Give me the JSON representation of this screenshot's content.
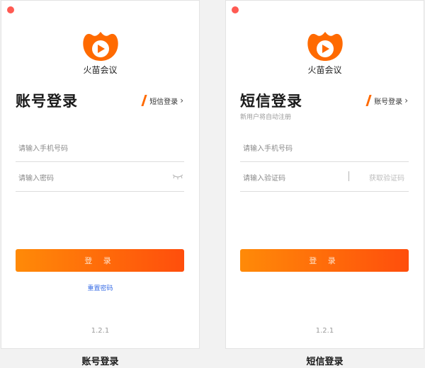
{
  "app": {
    "name": "火苗会议",
    "version": "1.2.1"
  },
  "account_login": {
    "title": "账号登录",
    "switch_label": "短信登录",
    "phone_placeholder": "请输入手机号码",
    "password_placeholder": "请输入密码",
    "login_label": "登 录",
    "reset_label": "重置密码",
    "caption": "账号登录"
  },
  "sms_login": {
    "title": "短信登录",
    "subtitle": "新用户将自动注册",
    "switch_label": "账号登录",
    "phone_placeholder": "请输入手机号码",
    "code_placeholder": "请输入验证码",
    "get_code_label": "获取验证码",
    "login_label": "登 录",
    "caption": "短信登录"
  },
  "colors": {
    "accent": "#ff6a00",
    "link": "#3a6ee6",
    "close_dot": "#ff5a52"
  },
  "icons": [
    "close-dot-icon",
    "flame-play-logo-icon",
    "slash-accent-icon",
    "chevron-right-icon",
    "eye-closed-icon"
  ]
}
